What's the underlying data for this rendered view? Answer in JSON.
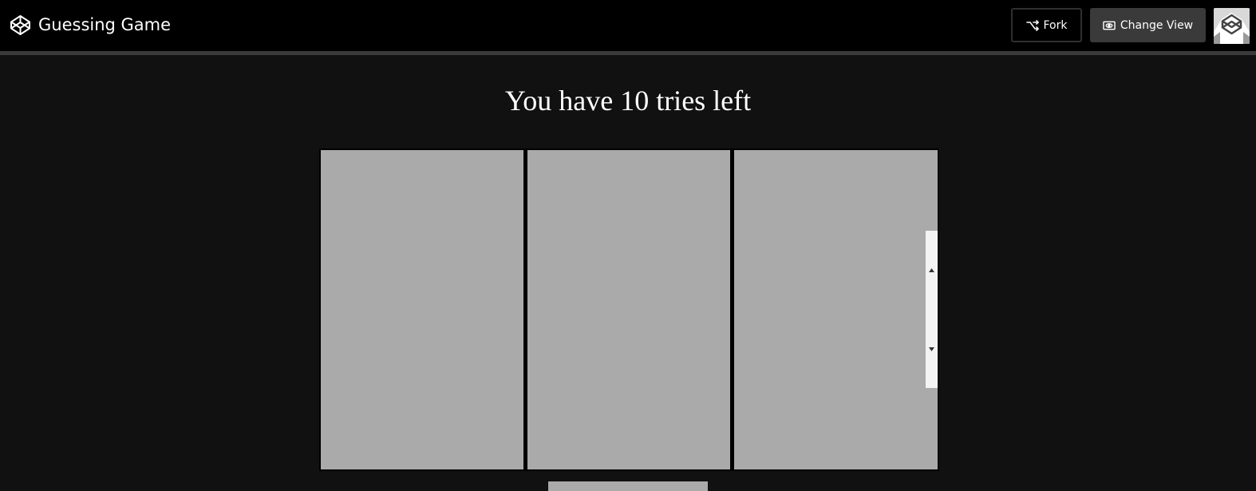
{
  "header": {
    "title": "Guessing Game",
    "fork_label": "Fork",
    "change_view_label": "Change View",
    "logo_icon": "codepen-logo-icon",
    "fork_icon": "fork-icon",
    "change_view_icon": "eye-icon",
    "avatar_icon": "codepen-avatar-icon"
  },
  "game": {
    "tries_text": "You have 10 tries left",
    "cards": [
      {
        "id": "card-1"
      },
      {
        "id": "card-2"
      },
      {
        "id": "card-3"
      }
    ]
  },
  "colors": {
    "topbar": "#000000",
    "page_background": "#111111",
    "card": "#aaaaaa",
    "text": "#ffffff"
  }
}
